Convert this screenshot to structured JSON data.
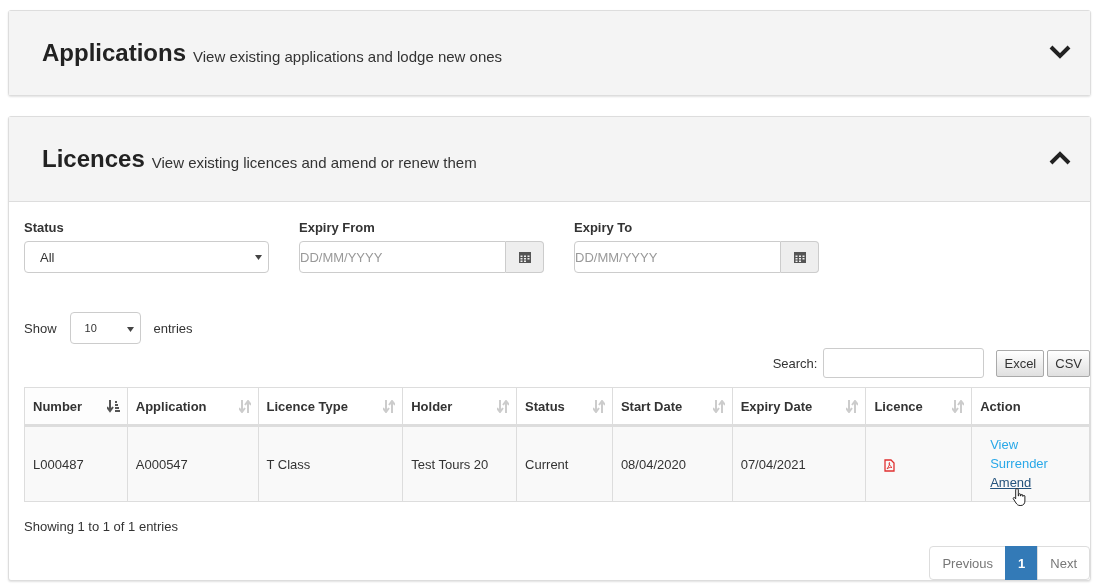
{
  "panels": [
    {
      "title": "Applications",
      "subtitle": "View existing applications and lodge new ones",
      "expanded": false
    },
    {
      "title": "Licences",
      "subtitle": "View existing licences and amend or renew them",
      "expanded": true
    }
  ],
  "filters": [
    {
      "kind": "select",
      "label": "Status",
      "value": "All"
    },
    {
      "kind": "date",
      "label": "Expiry From",
      "placeholder": "DD/MM/YYYY"
    },
    {
      "kind": "date",
      "label": "Expiry To",
      "placeholder": "DD/MM/YYYY"
    }
  ],
  "length_menu": {
    "before": "Show",
    "value": "10",
    "after": "entries"
  },
  "search": {
    "label": "Search:"
  },
  "export_buttons": [
    "Excel",
    "CSV"
  ],
  "table": {
    "columns": [
      {
        "label": "Number",
        "sortable": true,
        "sorted": true
      },
      {
        "label": "Application",
        "sortable": true,
        "sorted": false
      },
      {
        "label": "Licence Type",
        "sortable": true,
        "sorted": false
      },
      {
        "label": "Holder",
        "sortable": true,
        "sorted": false
      },
      {
        "label": "Status",
        "sortable": true,
        "sorted": false
      },
      {
        "label": "Start Date",
        "sortable": true,
        "sorted": false
      },
      {
        "label": "Expiry Date",
        "sortable": true,
        "sorted": false
      },
      {
        "label": "Licence",
        "sortable": true,
        "sorted": false
      },
      {
        "label": "Action",
        "sortable": false
      }
    ],
    "rows": [
      {
        "cells": [
          "L000487",
          "A000547",
          "T Class",
          "Test Tours 20",
          "Current",
          "08/04/2020",
          "07/04/2021"
        ],
        "licence": {
          "kind": "pdf"
        },
        "actions": [
          {
            "label": "View",
            "hovered": false
          },
          {
            "label": "Surrender",
            "hovered": false
          },
          {
            "label": "Amend",
            "hovered": true
          }
        ]
      }
    ]
  },
  "info": "Showing 1 to 1 of 1 entries",
  "pagination": [
    {
      "label": "Previous",
      "selected": false
    },
    {
      "label": "1",
      "selected": true
    },
    {
      "label": "Next",
      "selected": false
    }
  ]
}
